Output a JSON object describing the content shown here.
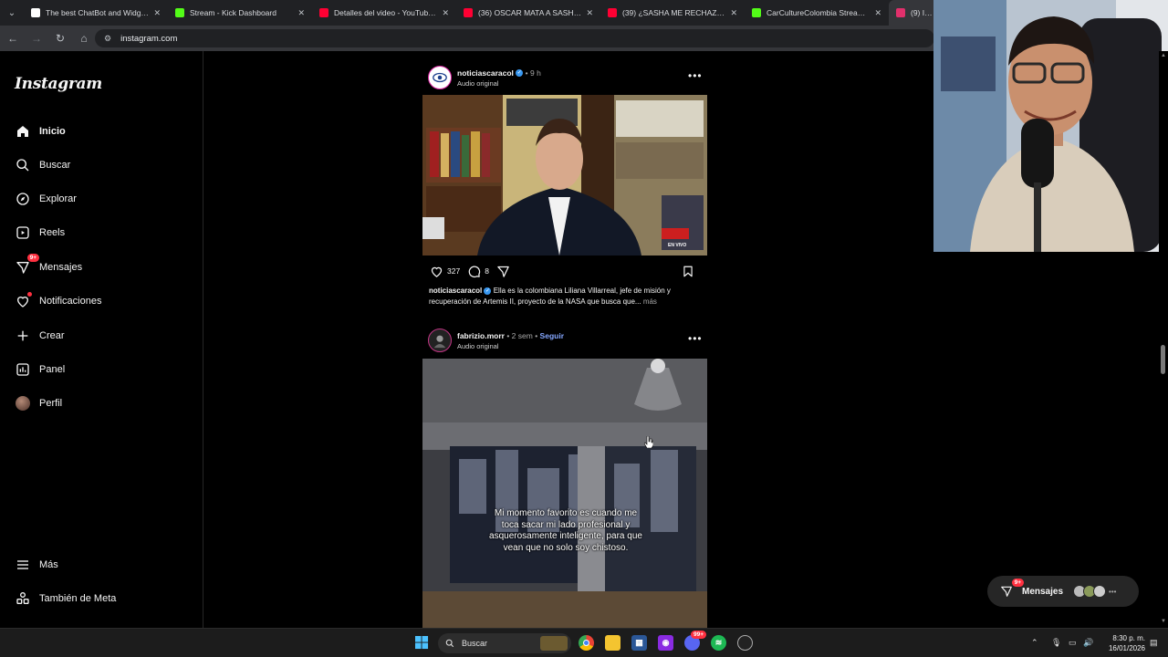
{
  "browser": {
    "tabs": [
      {
        "title": "The best ChatBot and Widgets",
        "favicon": "chatbot-icon",
        "color": "#ffffff"
      },
      {
        "title": "Stream - Kick Dashboard",
        "favicon": "kick-icon",
        "color": "#53fc18"
      },
      {
        "title": "Detalles del video - YouTube St",
        "favicon": "youtube-icon",
        "color": "#ff0033"
      },
      {
        "title": "(36) OSCAR MATA A SASHA 🙈",
        "favicon": "youtube-icon",
        "color": "#ff0033"
      },
      {
        "title": "(39) ¿SASHA ME RECHAZA EN",
        "favicon": "youtube-icon",
        "color": "#ff0033"
      },
      {
        "title": "CarCultureColombia Stream - V",
        "favicon": "kick-icon",
        "color": "#53fc18"
      },
      {
        "title": "(9) Insta",
        "favicon": "instagram-icon",
        "color": "#e1306c"
      }
    ],
    "url": "instagram.com"
  },
  "sidebar": {
    "logo": "Instagram",
    "items": [
      {
        "label": "Inicio",
        "icon": "home-icon"
      },
      {
        "label": "Buscar",
        "icon": "search-icon"
      },
      {
        "label": "Explorar",
        "icon": "compass-icon"
      },
      {
        "label": "Reels",
        "icon": "reels-icon"
      },
      {
        "label": "Mensajes",
        "icon": "messenger-icon",
        "badge": "9+"
      },
      {
        "label": "Notificaciones",
        "icon": "heart-icon"
      },
      {
        "label": "Crear",
        "icon": "plus-icon"
      },
      {
        "label": "Panel",
        "icon": "dashboard-icon"
      },
      {
        "label": "Perfil",
        "icon": "avatar"
      }
    ],
    "bottom": [
      {
        "label": "Más",
        "icon": "hamburger-icon"
      },
      {
        "label": "También de Meta",
        "icon": "meta-icon"
      }
    ]
  },
  "feed": {
    "post1": {
      "username": "noticiascaracol",
      "time": "9 h",
      "audio": "Audio original",
      "likes": "327",
      "comments": "8",
      "caption_user": "noticiascaracol",
      "caption": "Ella es la colombiana Liliana Villarreal, jefe de misión y recuperación de Artemis II, proyecto de la NASA que busca que...",
      "more": "más",
      "media_overlay": "EN VIVO"
    },
    "post2": {
      "username": "fabrizio.morr",
      "time": "2 sem",
      "follow": "Seguir",
      "audio": "Audio original",
      "subtitle": "Mi momento favorito es cuando me toca sacar mi lado profesional y asquerosamente inteligente, para que vean que no solo soy chistoso."
    }
  },
  "messages_pill": {
    "label": "Mensajes",
    "badge": "9+"
  },
  "taskbar": {
    "search": "Buscar",
    "time": "8:30 p. m.",
    "date": "16/01/2026",
    "discord_badge": "99+"
  }
}
